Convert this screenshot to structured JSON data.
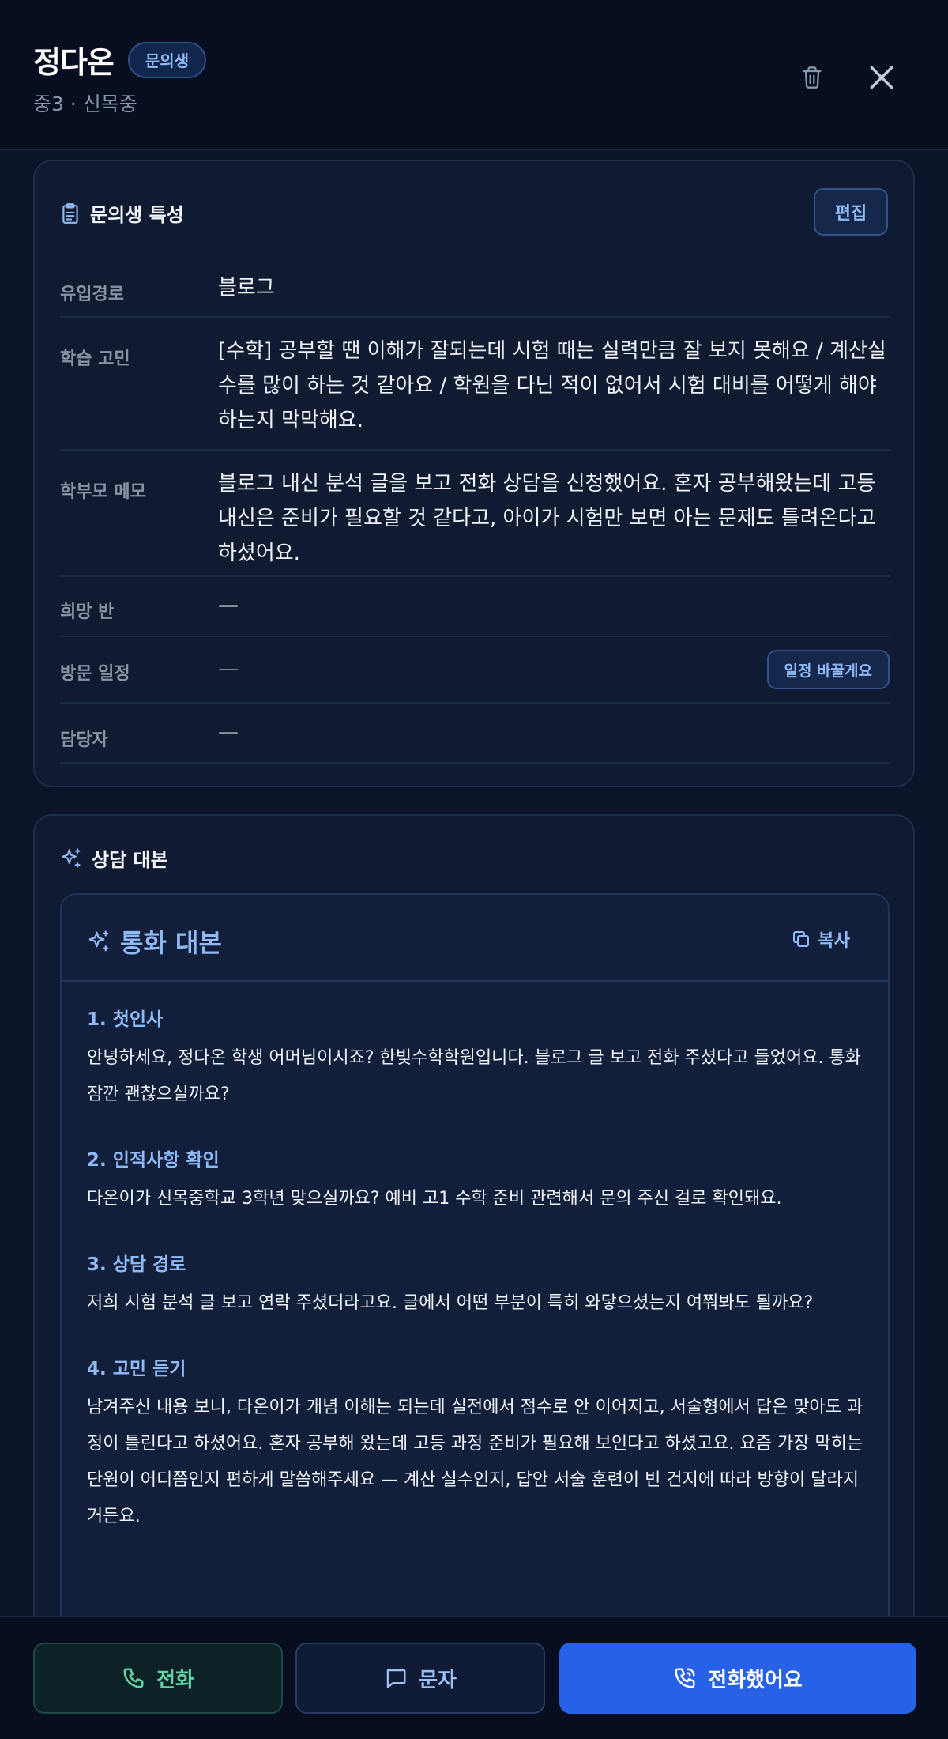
{
  "header": {
    "name": "정다온",
    "badge": "문의생",
    "sub_info": "중3 · 신목중",
    "icons": {
      "trash": "trash-icon",
      "close": "close-icon"
    }
  },
  "profile_card": {
    "title": "문의생 특성",
    "edit_label": "편집",
    "rows": [
      {
        "label": "유입경로",
        "value": "블로그"
      },
      {
        "label": "학습 고민",
        "value": "[수학] 공부할 땐 이해가 잘되는데 시험 때는 실력만큼 잘 보지 못해요 / 계산실수를 많이 하는 것 같아요 / 학원을 다닌 적이 없어서 시험 대비를 어떻게 해야 하는지 막막해요."
      },
      {
        "label": "학부모 메모",
        "value": "블로그 내신 분석 글을 보고 전화 상담을 신청했어요. 혼자 공부해왔는데 고등 내신은 준비가 필요할 것 같다고, 아이가 시험만 보면 아는 문제도 틀려온다고 하셨어요."
      },
      {
        "label": "희망 반",
        "value": "—"
      },
      {
        "label": "방문 일정",
        "value": "—",
        "action": "일정 바꿀게요"
      },
      {
        "label": "담당자",
        "value": "—"
      }
    ]
  },
  "script_card": {
    "title": "상담 대본",
    "inner_title": "통화 대본",
    "copy_label": "복사",
    "sections": [
      {
        "heading": "1. 첫인사",
        "body": "안녕하세요, 정다온 학생 어머님이시죠? 한빛수학학원입니다. 블로그 글 보고 전화 주셨다고 들었어요. 통화 잠깐 괜찮으실까요?"
      },
      {
        "heading": "2. 인적사항 확인",
        "body": "다온이가 신목중학교 3학년 맞으실까요? 예비 고1 수학 준비 관련해서 문의 주신 걸로 확인돼요."
      },
      {
        "heading": "3. 상담 경로",
        "body": "저희 시험 분석 글 보고 연락 주셨더라고요. 글에서 어떤 부분이 특히 와닿으셨는지 여쭤봐도 될까요?"
      },
      {
        "heading": "4. 고민 듣기",
        "body": "남겨주신 내용 보니, 다온이가 개념 이해는 되는데 실전에서 점수로 안 이어지고, 서술형에서 답은 맞아도 과정이 틀린다고 하셨어요. 혼자 공부해 왔는데 고등 과정 준비가 필요해 보인다고 하셨고요. 요즘 가장 막히는 단원이 어디쯤인지 편하게 말씀해주세요 — 계산 실수인지, 답안 서술 훈련이 빈 건지에 따라 방향이 달라지거든요."
      }
    ]
  },
  "bottom_bar": {
    "call_label": "전화",
    "sms_label": "문자",
    "called_label": "전화했어요"
  },
  "colors": {
    "accent": "#8fbaf6",
    "primary": "#2762e6",
    "success": "#5fd6a3",
    "background": "#0b1428"
  }
}
